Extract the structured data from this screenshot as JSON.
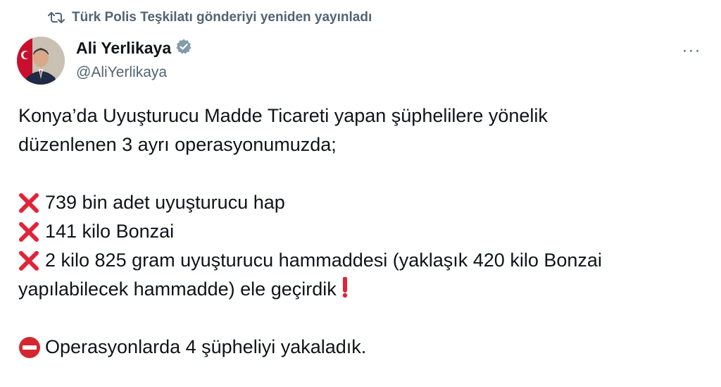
{
  "repost": {
    "text": "Türk Polis Teşkilatı gönderiyi yeniden yayınladı",
    "icon": "repost-icon"
  },
  "author": {
    "name": "Ali Yerlikaya",
    "handle": "@AliYerlikaya",
    "verified": true,
    "verified_color": "#829aab"
  },
  "more_label": "···",
  "tweet": {
    "intro_line1": "Konya’da Uyuşturucu Madde Ticareti yapan şüphelilere yönelik",
    "intro_line2": "düzenlenen 3 ayrı operasyonumuzda;",
    "items": [
      "739 bin adet uyuşturucu hap",
      "141 kilo Bonzai",
      "2 kilo 825 gram uyuşturucu hammaddesi (yaklaşık 420 kilo Bonzai"
    ],
    "item3_continuation": "yapılabilecek hammadde) ele geçirdik",
    "outro": "Operasyonlarda 4 şüpheliyi yakaladık."
  },
  "colors": {
    "text": "#0f1419",
    "secondary": "#536471",
    "cross_red": "#e0243a"
  }
}
